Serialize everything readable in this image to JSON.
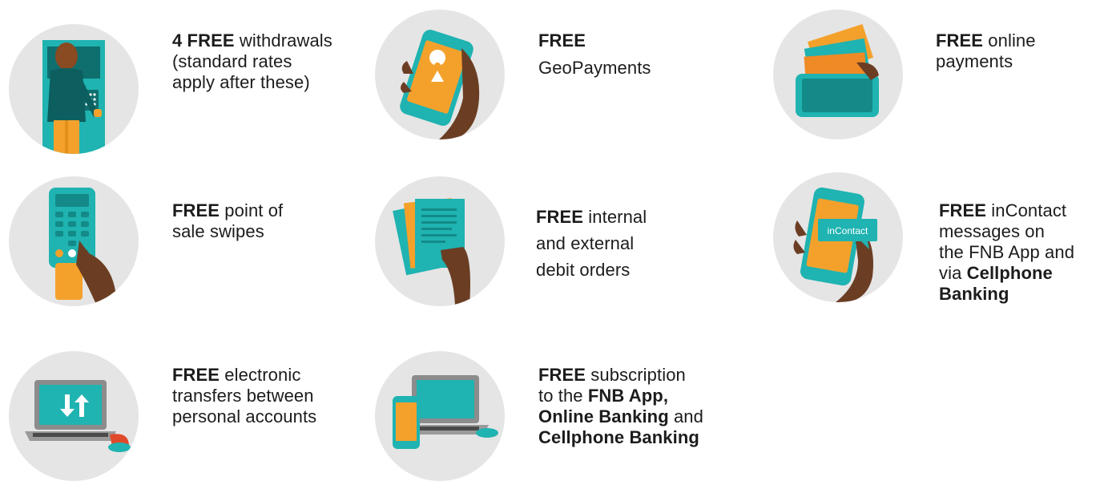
{
  "colors": {
    "circle_bg": "#e5e5e5",
    "teal": "#1fb3b1",
    "teal_dark": "#138a88",
    "orange": "#f4a12c",
    "skin": "#6b3e24",
    "text": "#1c1c1c"
  },
  "benefits": [
    {
      "icon": "atm-withdrawal-icon",
      "lines": [
        [
          {
            "bold": "4 FREE"
          },
          {
            "plain": " withdrawals"
          }
        ],
        [
          {
            "plain": "(standard rates"
          }
        ],
        [
          {
            "plain": "apply after these)"
          }
        ]
      ]
    },
    {
      "icon": "geopayments-phone-icon",
      "lines": [
        [
          {
            "bold": "FREE"
          }
        ],
        [
          {
            "plain": "GeoPayments"
          }
        ]
      ]
    },
    {
      "icon": "online-payments-icon",
      "lines": [
        [
          {
            "bold": "FREE"
          },
          {
            "plain": " online"
          }
        ],
        [
          {
            "plain": "payments"
          }
        ]
      ]
    },
    {
      "icon": "card-terminal-icon",
      "lines": [
        [
          {
            "bold": "FREE"
          },
          {
            "plain": " point of"
          }
        ],
        [
          {
            "plain": "sale swipes"
          }
        ]
      ]
    },
    {
      "icon": "debit-orders-document-icon",
      "lines": [
        [
          {
            "bold": "FREE"
          },
          {
            "plain": " internal"
          }
        ],
        [
          {
            "plain": "and external"
          }
        ],
        [
          {
            "plain": "debit orders"
          }
        ]
      ]
    },
    {
      "icon": "incontact-phone-icon",
      "icon_label": "inContact",
      "lines": [
        [
          {
            "bold": "FREE"
          },
          {
            "plain": " inContact"
          }
        ],
        [
          {
            "plain": "messages on"
          }
        ],
        [
          {
            "plain": "the FNB App and"
          }
        ],
        [
          {
            "plain": "via "
          },
          {
            "bold": "Cellphone"
          }
        ],
        [
          {
            "bold": "Banking"
          }
        ]
      ]
    },
    {
      "icon": "laptop-transfer-icon",
      "lines": [
        [
          {
            "bold": "FREE"
          },
          {
            "plain": " electronic"
          }
        ],
        [
          {
            "plain": "transfers between"
          }
        ],
        [
          {
            "plain": "personal accounts"
          }
        ]
      ]
    },
    {
      "icon": "laptop-phone-icon",
      "lines": [
        [
          {
            "bold": "FREE"
          },
          {
            "plain": " subscription"
          }
        ],
        [
          {
            "plain": "to the "
          },
          {
            "bold": "FNB App,"
          }
        ],
        [
          {
            "bold": "Online Banking"
          },
          {
            "plain": " and"
          }
        ],
        [
          {
            "bold": "Cellphone Banking"
          }
        ]
      ]
    }
  ]
}
